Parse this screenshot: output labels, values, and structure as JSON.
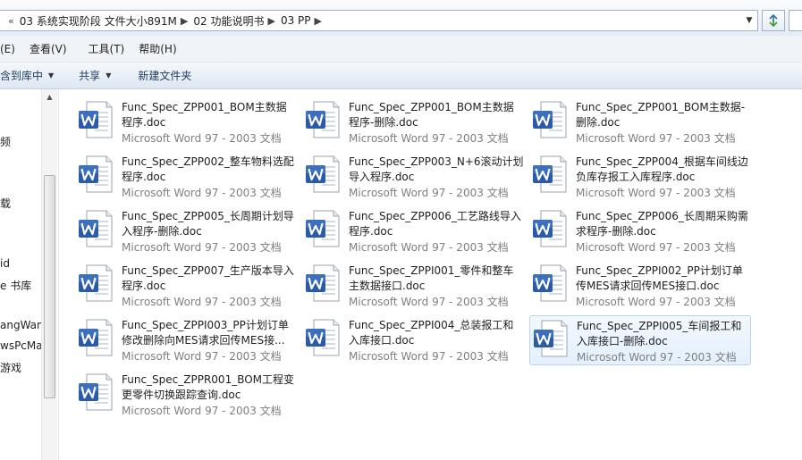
{
  "address_bar": {
    "crumbs": [
      "03 系统实现阶段 文件大小891M",
      "02 功能说明书",
      "03 PP"
    ]
  },
  "menu": {
    "items": [
      "(E)",
      "查看(V)",
      "工具(T)",
      "帮助(H)"
    ]
  },
  "command_bar": {
    "items": [
      {
        "label": "含到库中",
        "has_menu": true
      },
      {
        "label": "共享",
        "has_menu": true
      },
      {
        "label": "新建文件夹",
        "has_menu": false
      }
    ]
  },
  "sidebar": {
    "items": [
      "频",
      "载",
      "id",
      "e 书库",
      "angWan",
      "wsPcMa",
      "游戏"
    ]
  },
  "file_type_label": "Microsoft Word 97 - 2003 文档",
  "files": [
    {
      "name": "Func_Spec_ZPP001_BOM主数据程序.doc",
      "type": "Microsoft Word 97 - 2003 文档"
    },
    {
      "name": "Func_Spec_ZPP001_BOM主数据程序-删除.doc",
      "type": "Microsoft Word 97 - 2003 文档"
    },
    {
      "name": "Func_Spec_ZPP001_BOM主数据-删除.doc",
      "type": "Microsoft Word 97 - 2003 文档"
    },
    {
      "name": "Func_Spec_ZPP002_整车物料选配程序.doc",
      "type": "Microsoft Word 97 - 2003 文档"
    },
    {
      "name": "Func_Spec_ZPP003_N+6滚动计划导入程序.doc",
      "type": "Microsoft Word 97 - 2003 文档"
    },
    {
      "name": "Func_Spec_ZPP004_根据车间线边负库存报工入库程序.doc",
      "type": "Microsoft Word 97 - 2003 文档"
    },
    {
      "name": "Func_Spec_ZPP005_长周期计划导入程序-删除.doc",
      "type": "Microsoft Word 97 - 2003 文档"
    },
    {
      "name": "Func_Spec_ZPP006_工艺路线导入程序.doc",
      "type": "Microsoft Word 97 - 2003 文档"
    },
    {
      "name": "Func_Spec_ZPP006_长周期采购需求程序-删除.doc",
      "type": "Microsoft Word 97 - 2003 文档"
    },
    {
      "name": "Func_Spec_ZPP007_生产版本导入程序.doc",
      "type": "Microsoft Word 97 - 2003 文档"
    },
    {
      "name": "Func_Spec_ZPPI001_零件和整车主数据接口.doc",
      "type": "Microsoft Word 97 - 2003 文档"
    },
    {
      "name": "Func_Spec_ZPPI002_PP计划订单传MES请求回传MES接口.doc",
      "type": "Microsoft Word 97 - 2003 文档"
    },
    {
      "name": "Func_Spec_ZPPI003_PP计划订单修改删除向MES请求回传MES接...",
      "type": "Microsoft Word 97 - 2003 文档"
    },
    {
      "name": "Func_Spec_ZPPI004_总装报工和入库接口.doc",
      "type": "Microsoft Word 97 - 2003 文档"
    },
    {
      "name": "Func_Spec_ZPPI005_车间报工和入库接口-删除.doc",
      "type": "Microsoft Word 97 - 2003 文档",
      "selected": true
    },
    {
      "name": "Func_Spec_ZPPR001_BOM工程变更零件切换跟踪查询.doc",
      "type": "Microsoft Word 97 - 2003 文档"
    }
  ]
}
